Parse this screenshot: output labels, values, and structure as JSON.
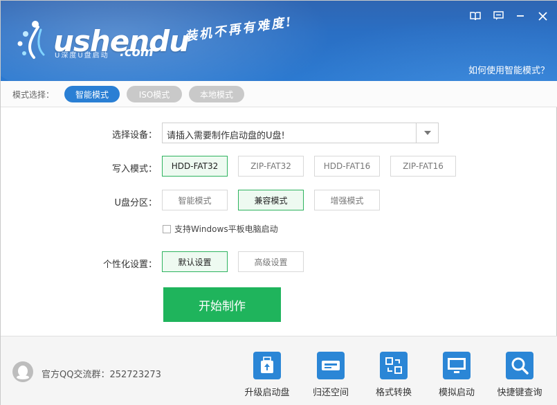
{
  "header": {
    "logo_text": "ushendu",
    "logo_dotcom": ".com",
    "logo_sub": "U深度U盘启动",
    "slogan": "装机不再有难度!",
    "help_link": "如何使用智能模式？"
  },
  "mode_bar": {
    "label": "模式选择：",
    "modes": [
      "智能模式",
      "ISO模式",
      "本地模式"
    ],
    "active_mode": "智能模式"
  },
  "form": {
    "device": {
      "label": "选择设备：",
      "value": "请插入需要制作启动盘的U盘!"
    },
    "write_mode": {
      "label": "写入模式：",
      "options": [
        "HDD-FAT32",
        "ZIP-FAT32",
        "HDD-FAT16",
        "ZIP-FAT16"
      ],
      "selected": "HDD-FAT32"
    },
    "partition": {
      "label": "U盘分区：",
      "options": [
        "智能模式",
        "兼容模式",
        "增强模式"
      ],
      "selected": "兼容模式"
    },
    "windows_tablet": {
      "label": "支持Windows平板电脑启动",
      "checked": false
    },
    "personalize": {
      "label": "个性化设置：",
      "options": [
        "默认设置",
        "高级设置"
      ],
      "selected": "默认设置"
    },
    "start_button": "开始制作"
  },
  "footer": {
    "qq_group": "官方QQ交流群：252723273",
    "tools": [
      {
        "label": "升级启动盘",
        "icon": "upload-drive-icon"
      },
      {
        "label": "归还空间",
        "icon": "disk-restore-icon"
      },
      {
        "label": "格式转换",
        "icon": "format-convert-icon"
      },
      {
        "label": "模拟启动",
        "icon": "monitor-icon"
      },
      {
        "label": "快捷键查询",
        "icon": "search-icon"
      }
    ]
  },
  "colors": {
    "header_blue": "#2b6fc4",
    "accent_blue": "#2a7fd4",
    "primary_green": "#1fb45c",
    "selected_option_bg": "#eefaf1",
    "selected_option_border": "#2db35e"
  }
}
